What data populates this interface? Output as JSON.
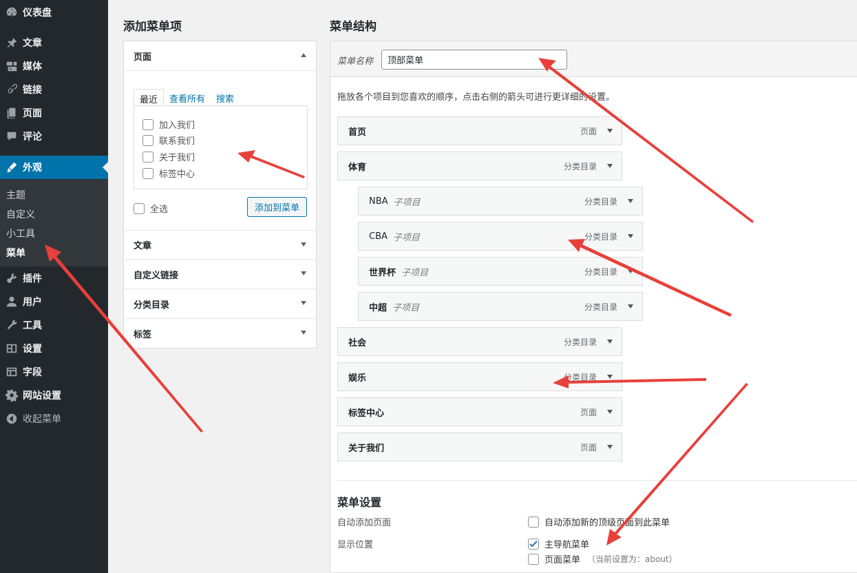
{
  "sidebar": {
    "items": [
      {
        "label": "仪表盘",
        "icon": "dashboard-icon"
      },
      {
        "label": "文章",
        "icon": "pin-icon"
      },
      {
        "label": "媒体",
        "icon": "media-icon"
      },
      {
        "label": "链接",
        "icon": "link-icon"
      },
      {
        "label": "页面",
        "icon": "page-icon"
      },
      {
        "label": "评论",
        "icon": "comment-icon"
      },
      {
        "label": "外观",
        "icon": "brush-icon"
      },
      {
        "label": "插件",
        "icon": "plugin-icon"
      },
      {
        "label": "用户",
        "icon": "user-icon"
      },
      {
        "label": "工具",
        "icon": "wrench-icon"
      },
      {
        "label": "设置",
        "icon": "settings-icon"
      },
      {
        "label": "字段",
        "icon": "table-icon"
      },
      {
        "label": "网站设置",
        "icon": "gear-icon"
      },
      {
        "label": "收起菜单",
        "icon": "collapse-icon"
      }
    ],
    "submenu": [
      "主题",
      "自定义",
      "小工具",
      "菜单"
    ]
  },
  "add_items": {
    "heading": "添加菜单项",
    "sections": [
      "页面",
      "文章",
      "自定义链接",
      "分类目录",
      "标签"
    ],
    "tabs": [
      "最近",
      "查看所有",
      "搜索"
    ],
    "pages": [
      "加入我们",
      "联系我们",
      "关于我们",
      "标签中心"
    ],
    "select_all": "全选",
    "add_button": "添加到菜单"
  },
  "structure": {
    "heading": "菜单结构",
    "name_label": "菜单名称",
    "name_value": "顶部菜单",
    "instructions": "拖放各个项目到您喜欢的顺序，点击右侧的箭头可进行更详细的设置。",
    "items": [
      {
        "title": "首页",
        "sub": "",
        "type": "页面"
      },
      {
        "title": "体育",
        "sub": "",
        "type": "分类目录"
      },
      {
        "title": "NBA",
        "sub": "子项目",
        "type": "分类目录"
      },
      {
        "title": "CBA",
        "sub": "子项目",
        "type": "分类目录"
      },
      {
        "title": "世界杯",
        "sub": "子项目",
        "type": "分类目录"
      },
      {
        "title": "中超",
        "sub": "子项目",
        "type": "分类目录"
      },
      {
        "title": "社会",
        "sub": "",
        "type": "分类目录"
      },
      {
        "title": "娱乐",
        "sub": "",
        "type": "分类目录"
      },
      {
        "title": "标签中心",
        "sub": "",
        "type": "页面"
      },
      {
        "title": "关于我们",
        "sub": "",
        "type": "页面"
      }
    ]
  },
  "settings": {
    "title": "菜单设置",
    "auto_add_label": "自动添加页面",
    "auto_add_option": "自动添加新的顶级页面到此菜单",
    "location_label": "显示位置",
    "primary_nav": "主导航菜单",
    "page_menu": "页面菜单",
    "page_menu_note": "（当前设置为：about）"
  },
  "colors": {
    "sidebar_bg": "#23282d",
    "active_bg": "#0073aa",
    "arrow": "#e8403a"
  }
}
